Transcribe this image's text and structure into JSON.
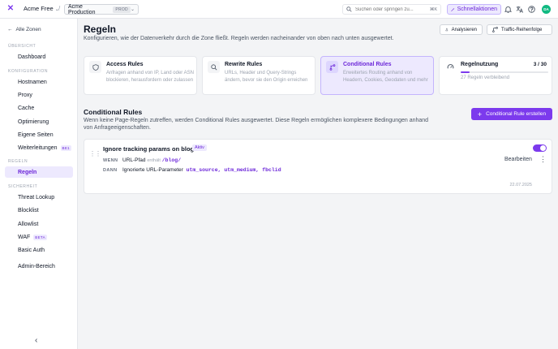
{
  "topbar": {
    "org": "Acme Free",
    "separator": "/",
    "zone": "Acme Production",
    "zone_badge": "PROD",
    "search_placeholder": "Suchen oder springen zu...",
    "search_shortcut": "⌘K",
    "quick_actions": "Schnellaktionen",
    "avatar": "DA"
  },
  "sidebar": {
    "back": "Alle Zonen",
    "sections": {
      "overview": "ÜBERSICHT",
      "config": "KONFIGURATION",
      "rules": "REGELN",
      "security": "SICHERHEIT"
    },
    "items": {
      "dashboard": "Dashboard",
      "hostnames": "Hostnamen",
      "proxy": "Proxy",
      "cache": "Cache",
      "optimization": "Optimierung",
      "pages": "Eigene Seiten",
      "redirects": "Weiterleitungen",
      "rules": "Regeln",
      "threat": "Threat Lookup",
      "blocklist": "Blocklist",
      "allowlist": "Allowlist",
      "waf": "WAF",
      "basic_auth": "Basic Auth",
      "admin": "Admin-Bereich"
    },
    "beta": "BETA",
    "beta_short": "BE1"
  },
  "header": {
    "title": "Regeln",
    "subtitle": "Konfigurieren, wie der Datenverkehr durch die Zone fließt. Regeln werden nacheinander von oben nach unten ausgewertet.",
    "analyze": "Analysieren",
    "traffic_order": "Traffic-Reihenfolge"
  },
  "cards": [
    {
      "title": "Access Rules",
      "desc": "Anfragen anhand von IP, Land oder ASN blockieren, herausfordern oder zulassen"
    },
    {
      "title": "Rewrite Rules",
      "desc": "URLs, Header und Query-Strings ändern, bevor sie den Origin erreichen"
    },
    {
      "title": "Conditional Rules",
      "desc": "Erweitertes Routing anhand von Headern, Cookies, Geodaten und mehr"
    }
  ],
  "usage": {
    "title": "Regelnutzung",
    "count": "3 / 30",
    "used_fraction": 0.1,
    "remaining": "27 Regeln verbleibend"
  },
  "conditional": {
    "title": "Conditional Rules",
    "desc": "Wenn keine Page-Regeln zutreffen, werden Conditional Rules ausgewertet. Diese Regeln ermöglichen komplexere Bedingungen anhand von Anfrageeigenschaften.",
    "create": "Conditional Rule erstellen"
  },
  "rule": {
    "name": "Ignore tracking params on blog",
    "status": "Aktiv",
    "when_label": "WENN",
    "when_field": "URL-Pfad",
    "when_op": "enthält",
    "when_value": "/blog/",
    "then_label": "DANN",
    "then_action": "Ignorierte URL-Parameter",
    "then_value": "utm_source, utm_medium, fbclid",
    "edit": "Bearbeiten",
    "date": "22.07.2025"
  },
  "colors": {
    "accent": "#7c3aed",
    "accent_light": "#ede9fe"
  }
}
